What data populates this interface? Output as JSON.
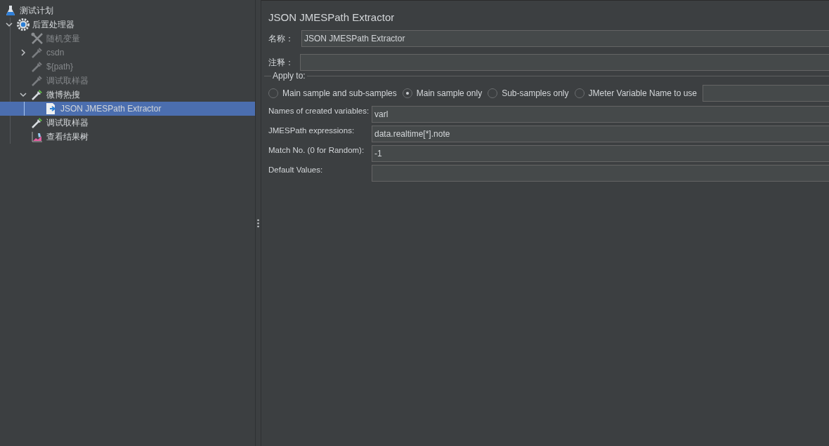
{
  "tree": [
    {
      "label": "测试计划",
      "kind": "plan",
      "disabled": false,
      "selected": false,
      "children": [
        {
          "label": "后置处理器",
          "kind": "controller",
          "expanded": true,
          "disabled": false,
          "selected": false,
          "children": [
            {
              "label": "随机变量",
              "kind": "config",
              "disabled": true,
              "selected": false
            },
            {
              "label": "csdn",
              "kind": "sampler",
              "expanded": false,
              "disabled": true,
              "selected": false
            },
            {
              "label": "${path}",
              "kind": "sampler",
              "disabled": true,
              "selected": false
            },
            {
              "label": "调试取样器",
              "kind": "sampler",
              "disabled": true,
              "selected": false
            },
            {
              "label": "微博热搜",
              "kind": "sampler",
              "expanded": true,
              "disabled": false,
              "selected": false,
              "children": [
                {
                  "label": "JSON JMESPath Extractor",
                  "kind": "extractor",
                  "disabled": false,
                  "selected": true
                }
              ]
            },
            {
              "label": "调试取样器",
              "kind": "sampler",
              "disabled": false,
              "selected": false
            },
            {
              "label": "查看结果树",
              "kind": "listener",
              "disabled": false,
              "selected": false
            }
          ]
        }
      ]
    }
  ],
  "panel": {
    "title": "JSON JMESPath Extractor",
    "name_label": "名称：",
    "name_value": "JSON JMESPath Extractor",
    "comment_label": "注释：",
    "apply_to": {
      "legend": "Apply to:",
      "options": [
        {
          "label": "Main sample and sub-samples",
          "selected": false
        },
        {
          "label": "Main sample only",
          "selected": true
        },
        {
          "label": "Sub-samples only",
          "selected": false
        },
        {
          "label": "JMeter Variable Name to use",
          "selected": false
        }
      ]
    },
    "fields": [
      {
        "label": "Names of created variables:",
        "value": "varl"
      },
      {
        "label": "JMESPath expressions:",
        "value": "data.realtime[*].note"
      },
      {
        "label": "Match No. (0 for Random):",
        "value": "-1"
      },
      {
        "label": "Default Values:"
      }
    ]
  }
}
